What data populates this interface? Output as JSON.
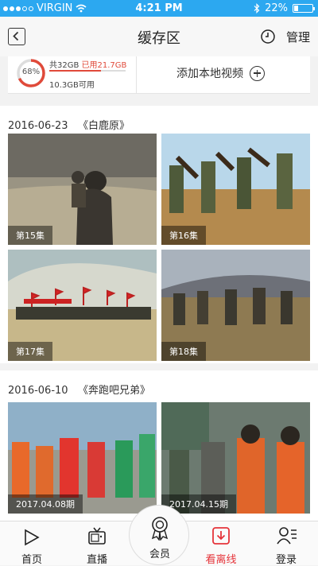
{
  "status": {
    "carrier": "VIRGIN",
    "time": "4:21 PM",
    "battery": "22%"
  },
  "nav": {
    "title": "缓存区",
    "manage": "管理"
  },
  "storage": {
    "percent_label": "68%",
    "percent": 68,
    "total": "共32GB",
    "used": "已用21.7GB",
    "available": "10.3GB可用",
    "add_local": "添加本地视频"
  },
  "sections": [
    {
      "date": "2016-06-23",
      "show": "《白鹿原》",
      "episodes": [
        "第15集",
        "第16集",
        "第17集",
        "第18集"
      ]
    },
    {
      "date": "2016-06-10",
      "show": "《奔跑吧兄弟》",
      "episodes": [
        "2017.04.08期",
        "2017.04.15期"
      ]
    }
  ],
  "tabs": [
    {
      "label": "首页",
      "icon": "play-icon"
    },
    {
      "label": "直播",
      "icon": "tv-icon"
    },
    {
      "label": "会员",
      "icon": "award-icon"
    },
    {
      "label": "看离线",
      "icon": "download-icon",
      "active": true
    },
    {
      "label": "登录",
      "icon": "user-icon"
    }
  ],
  "colors": {
    "accent": "#e5343a",
    "statusbar": "#2ca8f0"
  }
}
